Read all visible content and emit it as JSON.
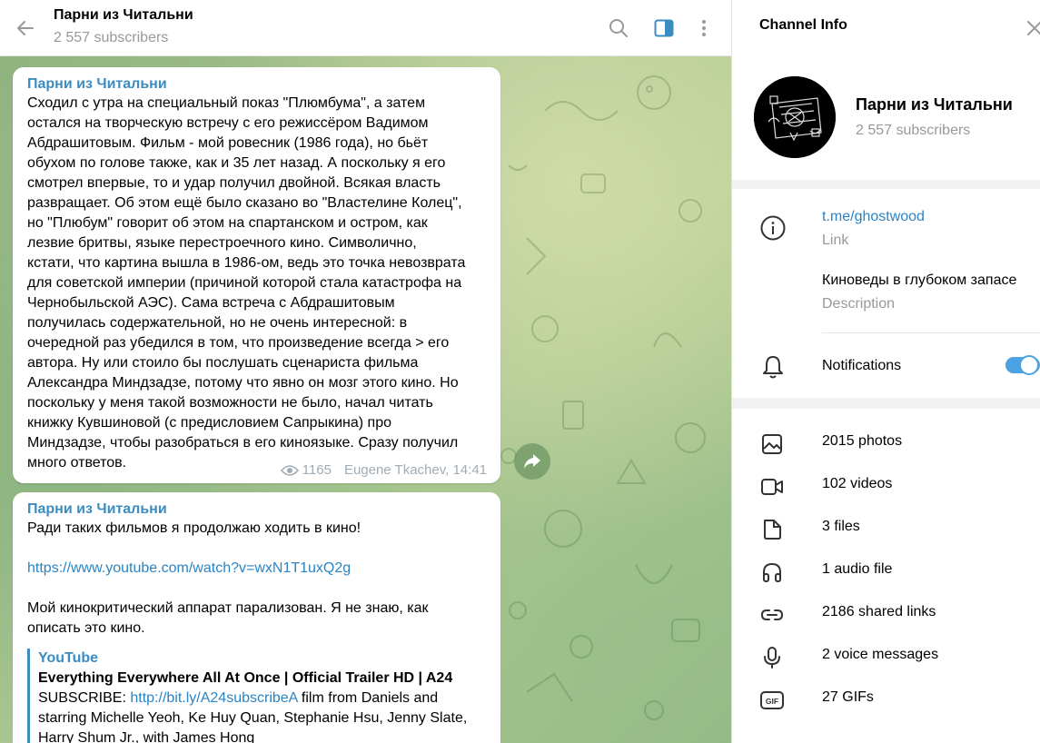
{
  "chat": {
    "title": "Парни из Читальни",
    "subtitle": "2 557 subscribers",
    "icons": [
      "back-arrow-icon",
      "search-icon",
      "sidebar-icon",
      "more-vertical-icon"
    ]
  },
  "messages": [
    {
      "author": "Парни из Читальни",
      "text": "Сходил с утра на специальный показ \"Плюмбума\", а затем\nостался на творческую встречу с его режиссёром Вадимом\nАбдрашитовым. Фильм - мой ровесник (1986 года), но бьёт\nобухом по голове также, как и 35 лет назад. А поскольку я его\nсмотрел впервые, то и удар получил двойной. Всякая власть\nразвращает. Об этом ещё было сказано во \"Властелине Колец\",\nно \"Плюбум\" говорит об этом на спартанском и остром, как\nлезвие бритвы, языке перестроечного кино. Символично,\nкстати, что картина вышла в 1986-ом, ведь это точка невозврата\nдля советской империи (причиной которой стала катастрофа на\nЧернобыльской АЭС). Сама встреча с Абдрашитовым\nполучилась содержательной, но не очень интересной: в\nочередной раз убедился в том, что произведение всегда > его\nавтора. Ну или стоило бы послушать сценариста фильма\nАлександра Миндзадзе, потому что явно он мозг этого кино. Но\nпоскольку у меня такой возможности не было, начал читать\nкнижку Кувшиновой (с предисловием Сапрыкина) про\nМиндзадзе, чтобы разобраться в его киноязыке. Сразу получил\nмного ответов.",
      "views": "1165",
      "signature": "Eugene Tkachev, 14:41"
    },
    {
      "author": "Парни из Читальни",
      "line1": "Ради таких фильмов я продолжаю ходить в кино!",
      "link": "https://www.youtube.com/watch?v=wxN1T1uxQ2g",
      "line2": "Мой кинокритический аппарат парализован. Я не знаю, как\nописать это кино.",
      "preview": {
        "site": "YouTube",
        "title": "Everything Everywhere All At Once | Official Trailer HD | A24",
        "desc_prefix": "SUBSCRIBE: ",
        "desc_link": "http://bit.ly/A24subscribeA",
        "desc_rest": " film from Daniels and",
        "desc_line2": "starring Michelle Yeoh, Ke Huy Quan, Stephanie Hsu, Jenny Slate,",
        "desc_line3": "Harry Shum Jr., with James Hong"
      }
    }
  ],
  "info": {
    "header": "Channel Info",
    "name": "Парни из Читальни",
    "subscribers": "2 557 subscribers",
    "link": "t.me/ghostwood",
    "link_label": "Link",
    "description": "Киноведы в глубоком запасе",
    "description_label": "Description",
    "notifications": "Notifications",
    "notifications_on": true,
    "media": [
      {
        "icon": "photo-icon",
        "label": "2015 photos"
      },
      {
        "icon": "video-icon",
        "label": "102 videos"
      },
      {
        "icon": "file-icon",
        "label": "3 files"
      },
      {
        "icon": "headphones-icon",
        "label": "1 audio file"
      },
      {
        "icon": "link-icon",
        "label": "2186 shared links"
      },
      {
        "icon": "microphone-icon",
        "label": "2 voice messages"
      },
      {
        "icon": "gif-icon",
        "label": "27 GIFs"
      }
    ]
  },
  "colors": {
    "accent": "#3a8cc1",
    "link": "#2a84c4",
    "toggle": "#4ba3e2"
  }
}
